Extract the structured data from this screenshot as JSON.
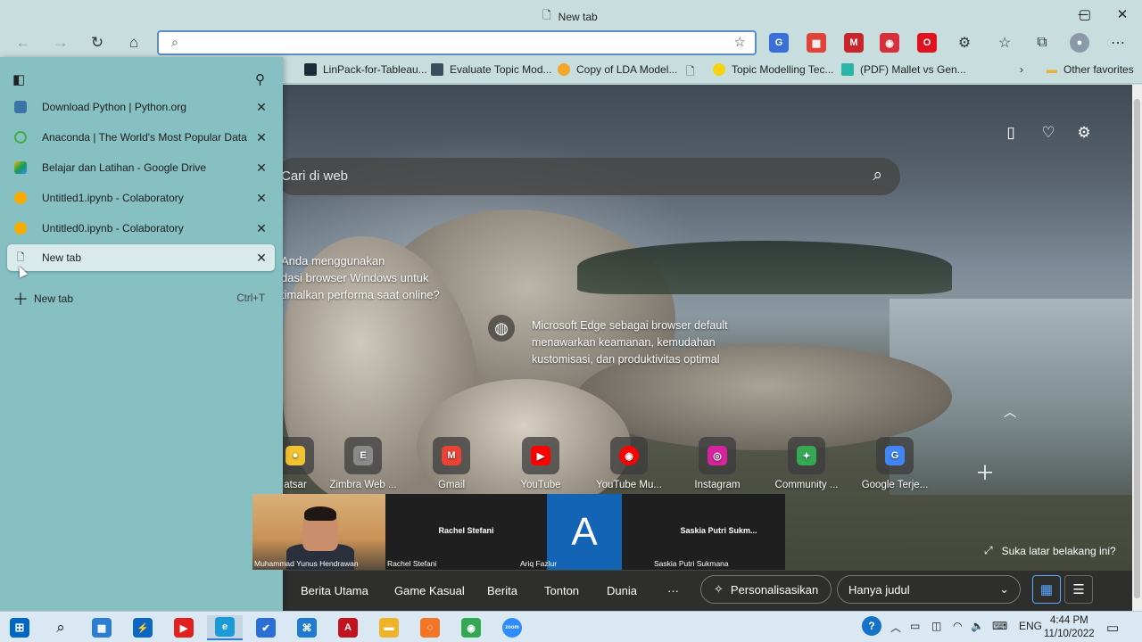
{
  "window": {
    "title": "New tab",
    "minimize": "─",
    "maximize": "▢",
    "close": "✕"
  },
  "toolbar": {
    "address_value": "",
    "extensions": [
      {
        "name": "translate-icon",
        "color": "#3b6fd8",
        "glyph": "G"
      },
      {
        "name": "extension-red-grid-icon",
        "color": "#e0433a",
        "glyph": "▦"
      },
      {
        "name": "extension-mendeley-icon",
        "color": "#c9262c",
        "glyph": "M"
      },
      {
        "name": "extension-eye-icon",
        "color": "#d6303a",
        "glyph": "◉"
      },
      {
        "name": "extension-opera-icon",
        "color": "#e0121f",
        "glyph": "O"
      }
    ]
  },
  "favorites": [
    {
      "label": "LinPack-for-Tableau...",
      "color": "#1c2b39"
    },
    {
      "label": "Evaluate Topic Mod...",
      "color": "#3b4e5e"
    },
    {
      "label": "Copy of LDA Model...",
      "color": "#f1a72a"
    },
    {
      "label": "",
      "color": "#ffffff"
    },
    {
      "label": "Topic Modelling Tec...",
      "color": "#f6d311"
    },
    {
      "label": "(PDF) Mallet vs Gen...",
      "color": "#28b6a8"
    }
  ],
  "favorites_more": "Other favorites",
  "tabs": [
    {
      "label": "Download Python | Python.org",
      "color": "#3a73a8"
    },
    {
      "label": "Anaconda | The World's Most Popular Data Scier",
      "color": "#3fae48"
    },
    {
      "label": "Belajar dan Latihan - Google Drive",
      "color": "#f4b400"
    },
    {
      "label": "Untitled1.ipynb - Colaboratory",
      "color": "#f9ab00"
    },
    {
      "label": "Untitled0.ipynb - Colaboratory",
      "color": "#f9ab00"
    },
    {
      "label": "New tab",
      "color": "#ffffff"
    }
  ],
  "new_tab": {
    "label": "New tab",
    "shortcut": "Ctrl+T"
  },
  "search": {
    "placeholder": "Cari di web"
  },
  "promo": {
    "line1": "Anda menggunakan",
    "line2": "dasi browser Windows untuk",
    "line3": "timalkan performa saat online?"
  },
  "info_text": "Microsoft Edge sebagai browser default menawarkan keamanan, kemudahan kustomisasi, dan produktivitas optimal",
  "tiles": [
    {
      "label": "atsar",
      "color": "#f1c232",
      "glyph": "●"
    },
    {
      "label": "Zimbra Web ...",
      "color": "#8a8a8a",
      "glyph": "E"
    },
    {
      "label": "Gmail",
      "color": "#ea4335",
      "glyph": "M"
    },
    {
      "label": "YouTube",
      "color": "#ff0000",
      "glyph": "▶"
    },
    {
      "label": "YouTube Mu...",
      "color": "#ff0000",
      "glyph": "◉"
    },
    {
      "label": "Instagram",
      "color": "#d6249f",
      "glyph": "◎"
    },
    {
      "label": "Community ...",
      "color": "#34a853",
      "glyph": "✦"
    },
    {
      "label": "Google Terje...",
      "color": "#4285f4",
      "glyph": "G"
    }
  ],
  "background_prompt": "Suka latar belakang ini?",
  "news_tabs": [
    "Berita Utama",
    "Game Kasual",
    "Berita",
    "Tonton",
    "Dunia"
  ],
  "news_more": "···",
  "personalize": "Personalisasikan",
  "filter_select": "Hanya judul",
  "call": {
    "p1_name": "Muhammad Yunus Hendrawan",
    "p2_center": "Rachel Stefani",
    "p2_name": "Rachel Stefani",
    "p3_letter": "A",
    "p3_name": "Ariq Fazlur",
    "p4_center": "Saskia  Putri  Sukm...",
    "p4_name": "Saskia Putri Sukmana"
  },
  "taskbar": {
    "apps": [
      {
        "name": "ms-store-icon",
        "color": "#2d7dd2",
        "glyph": "▦"
      },
      {
        "name": "power-automate-icon",
        "color": "#0a66c2",
        "glyph": "⚡"
      },
      {
        "name": "youtube-music-icon",
        "color": "#e32020",
        "glyph": "▶"
      },
      {
        "name": "edge-icon",
        "color": "#1a9ad6",
        "glyph": "e"
      },
      {
        "name": "todo-icon",
        "color": "#2b6fd6",
        "glyph": "✔"
      },
      {
        "name": "vscode-icon",
        "color": "#1f7ad0",
        "glyph": "⌘"
      },
      {
        "name": "acrobat-icon",
        "color": "#c1121f",
        "glyph": "A"
      },
      {
        "name": "file-explorer-icon",
        "color": "#f0b429",
        "glyph": "▬"
      },
      {
        "name": "jupyter-icon",
        "color": "#f37626",
        "glyph": "◌"
      },
      {
        "name": "chrome-icon",
        "color": "#34a853",
        "glyph": "◉"
      },
      {
        "name": "zoom-icon",
        "color": "#2d8cff",
        "glyph": "zoom"
      }
    ],
    "lang": "ENG",
    "time": "4:44 PM",
    "date": "11/10/2022"
  }
}
